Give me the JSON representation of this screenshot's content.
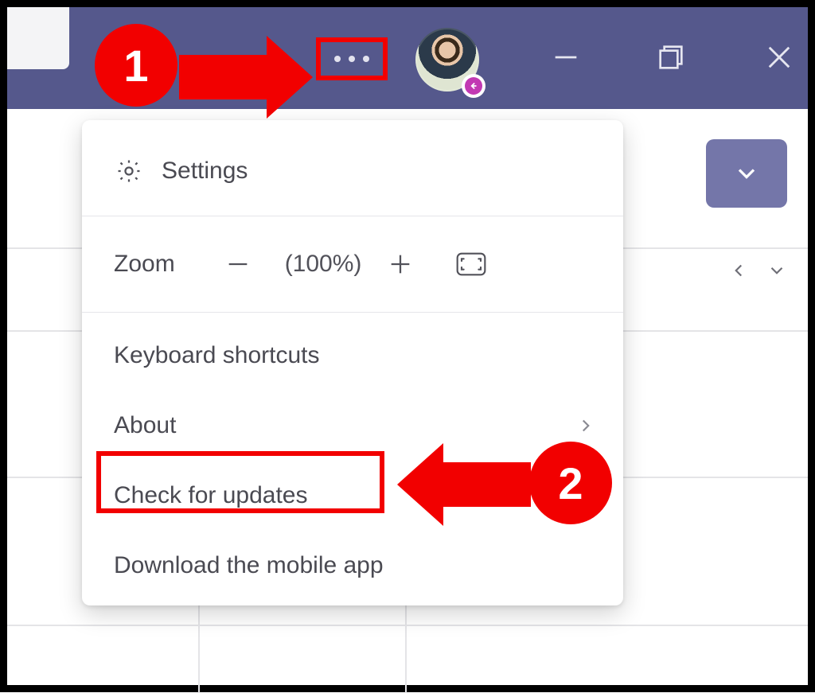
{
  "titlebar": {
    "more_tooltip": "More",
    "minimize": "Minimize",
    "maximize": "Maximize",
    "close": "Close"
  },
  "dropdown": {
    "label": "Expand"
  },
  "menu": {
    "settings": "Settings",
    "zoom_label": "Zoom",
    "zoom_pct": "(100%)",
    "keyboard_shortcuts": "Keyboard shortcuts",
    "about": "About",
    "check_updates": "Check for updates",
    "download_mobile": "Download the mobile app"
  },
  "annotations": {
    "step1": "1",
    "step2": "2"
  },
  "colors": {
    "titlebar_bg": "#55588c",
    "accent": "#7476a9",
    "highlight": "#f20000",
    "presence": "#c239b3"
  }
}
